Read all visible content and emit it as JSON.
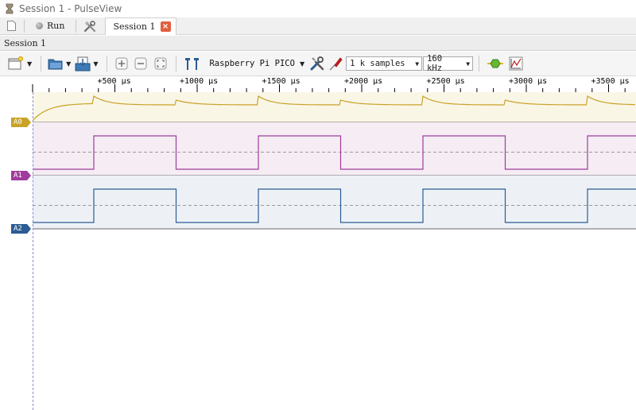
{
  "window": {
    "title": "Session 1 - PulseView"
  },
  "tabbar": {
    "run_label": "Run",
    "session_tab_label": "Session 1",
    "close_glyph": "×"
  },
  "session_header": {
    "label": "Session 1"
  },
  "toolbar": {
    "device": "Raspberry Pi PICO",
    "samples": "1 k samples",
    "samplerate": "160 kHz",
    "icons": [
      "new-session-icon",
      "open-icon",
      "save-icon",
      "zoom-in-icon",
      "zoom-out-icon",
      "zoom-fit-icon",
      "cursor-icon",
      "device-config-icon",
      "probe-icon",
      "decoder-icon",
      "math-icon"
    ]
  },
  "ruler": {
    "ticks": [
      "+500 µs",
      "+1000 µs",
      "+1500 µs",
      "+2000 µs",
      "+2500 µs",
      "+3000 µs",
      "+3500 µs"
    ]
  },
  "channels": [
    {
      "name": "A0",
      "color": "#c9a227",
      "bg": "#faf6e6"
    },
    {
      "name": "A1",
      "color": "#a03c9c",
      "bg": "#f5ecf4"
    },
    {
      "name": "A2",
      "color": "#2b5c93",
      "bg": "#edf1f6"
    }
  ]
}
